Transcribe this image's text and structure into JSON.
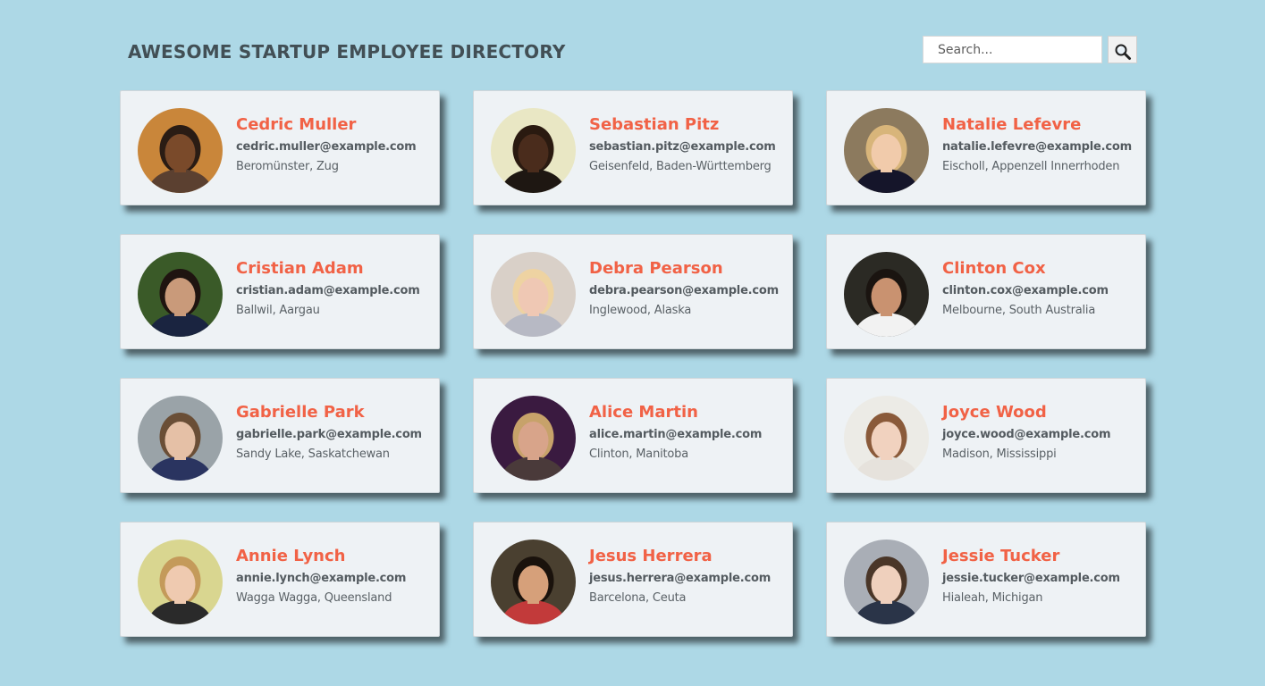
{
  "header": {
    "title": "AWESOME STARTUP EMPLOYEE DIRECTORY",
    "search_placeholder": "Search...",
    "search_icon": "magnifier-icon"
  },
  "colors": {
    "background": "#add8e6",
    "card": "#eef2f5",
    "name_accent": "#f16246",
    "title_text": "#424f55"
  },
  "employees": [
    {
      "name": "Cedric Muller",
      "email": "cedric.muller@example.com",
      "location": "Beromünster, Zug",
      "photo": {
        "bg": "#c9863a",
        "skin": "#7a4a2a",
        "hair": "#2a1c14",
        "shirt": "#5b4030"
      }
    },
    {
      "name": "Sebastian Pitz",
      "email": "sebastian.pitz@example.com",
      "location": "Geisenfeld, Baden-Württemberg",
      "photo": {
        "bg": "#e9e7c4",
        "skin": "#4a2c1c",
        "hair": "#2a1a10",
        "shirt": "#1e1712"
      }
    },
    {
      "name": "Natalie Lefevre",
      "email": "natalie.lefevre@example.com",
      "location": "Eischoll, Appenzell Innerrhoden",
      "photo": {
        "bg": "#8c7a5e",
        "skin": "#f1cbab",
        "hair": "#d8b57a",
        "shirt": "#15152a"
      }
    },
    {
      "name": "Cristian Adam",
      "email": "cristian.adam@example.com",
      "location": "Ballwil, Aargau",
      "photo": {
        "bg": "#3a5a28",
        "skin": "#c99a7a",
        "hair": "#1f1410",
        "shirt": "#1a2440"
      }
    },
    {
      "name": "Debra Pearson",
      "email": "debra.pearson@example.com",
      "location": "Inglewood, Alaska",
      "photo": {
        "bg": "#d9d0c8",
        "skin": "#efc8b4",
        "hair": "#eed3a2",
        "shirt": "#b7b9c4"
      }
    },
    {
      "name": "Clinton Cox",
      "email": "clinton.cox@example.com",
      "location": "Melbourne, South Australia",
      "photo": {
        "bg": "#2b2a24",
        "skin": "#c99270",
        "hair": "#1a1410",
        "shirt": "#f2f2f2"
      }
    },
    {
      "name": "Gabrielle Park",
      "email": "gabrielle.park@example.com",
      "location": "Sandy Lake, Saskatchewan",
      "photo": {
        "bg": "#9aa3a8",
        "skin": "#e5c0a6",
        "hair": "#6a4e36",
        "shirt": "#2a3460"
      }
    },
    {
      "name": "Alice Martin",
      "email": "alice.martin@example.com",
      "location": "Clinton, Manitoba",
      "photo": {
        "bg": "#3a1a40",
        "skin": "#d8a48a",
        "hair": "#c7a26a",
        "shirt": "#4a3a3a"
      }
    },
    {
      "name": "Joyce Wood",
      "email": "joyce.wood@example.com",
      "location": "Madison, Mississippi",
      "photo": {
        "bg": "#ecebe6",
        "skin": "#f1d2bf",
        "hair": "#8a5a3a",
        "shirt": "#e6e2dc"
      }
    },
    {
      "name": "Annie Lynch",
      "email": "annie.lynch@example.com",
      "location": "Wagga Wagga, Queensland",
      "photo": {
        "bg": "#d9d690",
        "skin": "#efcab0",
        "hair": "#c49a5a",
        "shirt": "#2a2a2a"
      }
    },
    {
      "name": "Jesus Herrera",
      "email": "jesus.herrera@example.com",
      "location": "Barcelona, Ceuta",
      "photo": {
        "bg": "#4a4030",
        "skin": "#d6a07a",
        "hair": "#1a120c",
        "shirt": "#c23a3a"
      }
    },
    {
      "name": "Jessie Tucker",
      "email": "jessie.tucker@example.com",
      "location": "Hialeah, Michigan",
      "photo": {
        "bg": "#a9aeb6",
        "skin": "#efd0bd",
        "hair": "#4a3628",
        "shirt": "#2a3448"
      }
    }
  ]
}
